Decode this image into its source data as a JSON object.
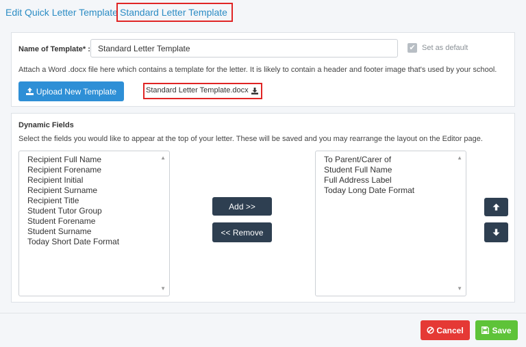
{
  "header": {
    "title": "Edit Quick Letter Template",
    "template_name": "Standard Letter Template"
  },
  "template": {
    "name_label": "Name of Template* :",
    "name_value": "Standard Letter Template",
    "set_default_label": "Set as default",
    "set_default_checked": true,
    "attach_text": "Attach a Word .docx file here which contains a template for the letter. It is likely to contain a header and footer image that's used by your school.",
    "upload_label": "Upload New Template",
    "file_name": "Standard Letter Template.docx"
  },
  "dynamic_fields": {
    "title": "Dynamic Fields",
    "description": "Select the fields you would like to appear at the top of your letter. These will be saved and you may rearrange the layout on the Editor page.",
    "available": [
      "Recipient Full Name",
      "Recipient Forename",
      "Recipient Initial",
      "Recipient Surname",
      "Recipient Title",
      "Student Tutor Group",
      "Student Forename",
      "Student Surname",
      "Today Short Date Format"
    ],
    "selected": [
      "To Parent/Carer of",
      "Student Full Name",
      "Full Address Label",
      "Today Long Date Format"
    ],
    "add_label": "Add >>",
    "remove_label": "<< Remove"
  },
  "footer": {
    "cancel_label": "Cancel",
    "save_label": "Save"
  },
  "icons": {
    "upload": "upload-icon",
    "download": "download-icon",
    "check": "check-icon",
    "arrow_up": "arrow-up-icon",
    "arrow_down": "arrow-down-icon",
    "cancel": "ban-icon",
    "save": "floppy-icon"
  },
  "colors": {
    "accent": "#2b8cc4",
    "primary_button": "#2e8fd6",
    "dark_button": "#2e3f51",
    "cancel": "#e53935",
    "save": "#5ec339",
    "highlight_border": "#e02424"
  }
}
